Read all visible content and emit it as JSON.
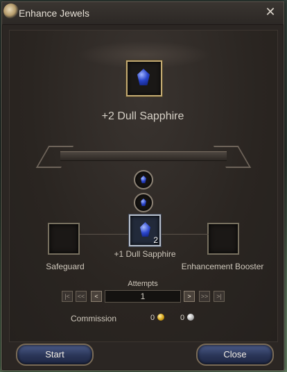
{
  "window": {
    "title": "Enhance Jewels",
    "close_icon": "close-icon"
  },
  "target_item": {
    "name": "+2 Dull Sapphire",
    "icon": "sapphire-icon"
  },
  "materials": {
    "slots": [
      {
        "icon": "sapphire-icon"
      },
      {
        "icon": "sapphire-icon"
      }
    ],
    "main": {
      "name": "+1 Dull Sapphire",
      "count": "2",
      "icon": "sapphire-icon"
    }
  },
  "side_slots": {
    "safeguard_label": "Safeguard",
    "booster_label": "Enhancement Booster"
  },
  "attempts": {
    "label": "Attempts",
    "value": "1",
    "nav": {
      "first": "|<",
      "prev_fast": "<<",
      "prev": "<",
      "next": ">",
      "next_fast": ">>",
      "last": ">|"
    }
  },
  "commission": {
    "label": "Commission",
    "gold": "0",
    "silver": "0"
  },
  "buttons": {
    "start": "Start",
    "close": "Close"
  }
}
